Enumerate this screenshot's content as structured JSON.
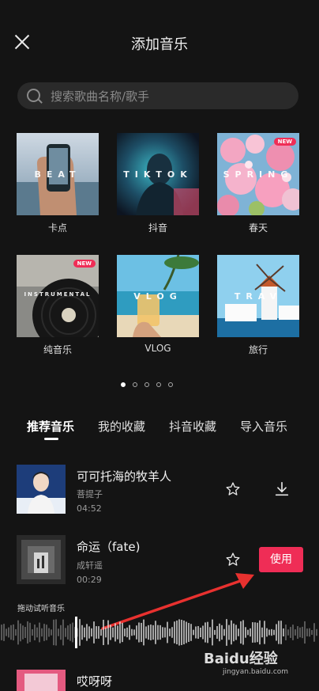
{
  "header": {
    "title": "添加音乐"
  },
  "search": {
    "placeholder": "搜索歌曲名称/歌手"
  },
  "categories": [
    {
      "label": "卡点",
      "overlay": "BEAT",
      "badge": ""
    },
    {
      "label": "抖音",
      "overlay": "TIKTOK",
      "badge": ""
    },
    {
      "label": "春天",
      "overlay": "SPRING",
      "badge": "NEW"
    },
    {
      "label": "纯音乐",
      "overlay": "INSTRUMENTAL",
      "badge": "NEW"
    },
    {
      "label": "VLOG",
      "overlay": "VLOG",
      "badge": ""
    },
    {
      "label": "旅行",
      "overlay": "TRAV",
      "badge": ""
    }
  ],
  "pagination": {
    "total": 5,
    "active": 1
  },
  "tabs": [
    {
      "label": "推荐音乐",
      "active": true
    },
    {
      "label": "我的收藏",
      "active": false
    },
    {
      "label": "抖音收藏",
      "active": false
    },
    {
      "label": "导入音乐",
      "active": false
    }
  ],
  "songs": [
    {
      "title": "可可托海的牧羊人",
      "artist": "菩提子",
      "duration": "04:52"
    },
    {
      "title": "命运（fate)",
      "artist": "成轩遥",
      "duration": "00:29",
      "action": "使用"
    },
    {
      "title": "哎呀呀"
    }
  ],
  "preview": {
    "hint": "拖动试听音乐"
  },
  "watermark": {
    "logo": "Baidu经验",
    "url": "jingyan.baidu.com"
  },
  "colors": {
    "accent": "#ef2d56",
    "background": "#141414"
  }
}
